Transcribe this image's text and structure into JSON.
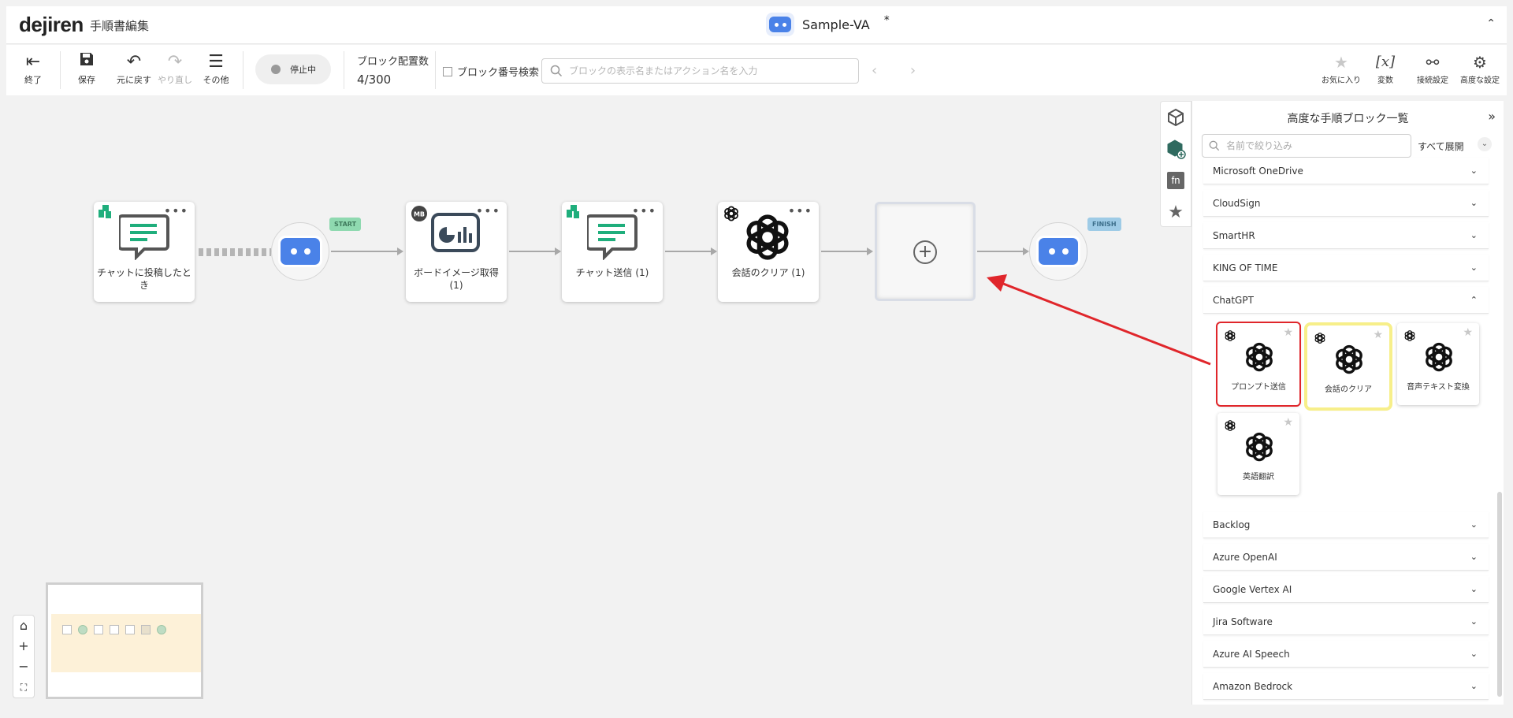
{
  "header": {
    "logo": "dejiren",
    "page_label": "手順書編集",
    "project_name": "Sample-VA",
    "unsaved_mark": "*",
    "collapse_glyph": "⌃"
  },
  "toolbar": {
    "exit": "終了",
    "save": "保存",
    "undo": "元に戻す",
    "redo": "やり直し",
    "more": "その他",
    "status": "停止中",
    "block_count_label": "ブロック配置数",
    "block_count_value": "4/300",
    "block_number_search": "ブロック番号検索",
    "search_placeholder": "ブロックの表示名またはアクション名を入力",
    "favorites": "お気に入り",
    "variables": "変数",
    "connection_settings": "接続設定",
    "advanced_settings": "高度な設定"
  },
  "canvas": {
    "blocks": [
      {
        "label": "チャットに投稿したとき"
      },
      {
        "label": "ボードイメージ取得 (1)"
      },
      {
        "label": "チャット送信 (1)"
      },
      {
        "label": "会話のクリア (1)"
      }
    ],
    "start_tag": "START",
    "finish_tag": "FINISH",
    "mb_badge": "MB",
    "dots": "•••"
  },
  "zoom_controls": {
    "home": "⌂",
    "zoom_in": "+",
    "zoom_out": "−",
    "fit": "⛶"
  },
  "panel": {
    "title": "高度な手順ブロック一覧",
    "close_glyph": "»",
    "filter_placeholder": "名前で絞り込み",
    "expand_all": "すべて展開",
    "categories_top": [
      {
        "name": "Microsoft OneDrive"
      },
      {
        "name": "CloudSign"
      },
      {
        "name": "SmartHR"
      },
      {
        "name": "KING OF TIME"
      },
      {
        "name": "ChatGPT"
      }
    ],
    "chatgpt_actions": [
      {
        "label": "プロンプト送信"
      },
      {
        "label": "会話のクリア"
      },
      {
        "label": "音声テキスト変換"
      },
      {
        "label": "英語翻訳"
      }
    ],
    "categories_bottom": [
      {
        "name": "Backlog"
      },
      {
        "name": "Azure OpenAI"
      },
      {
        "name": "Google Vertex AI"
      },
      {
        "name": "Jira Software"
      },
      {
        "name": "Azure AI Speech"
      },
      {
        "name": "Amazon Bedrock"
      }
    ]
  },
  "colors": {
    "accent_blue": "#4a82e8",
    "highlight_red": "#e0262b",
    "highlight_yellow": "#f7ef8a",
    "chat_green": "#1fae7c"
  }
}
